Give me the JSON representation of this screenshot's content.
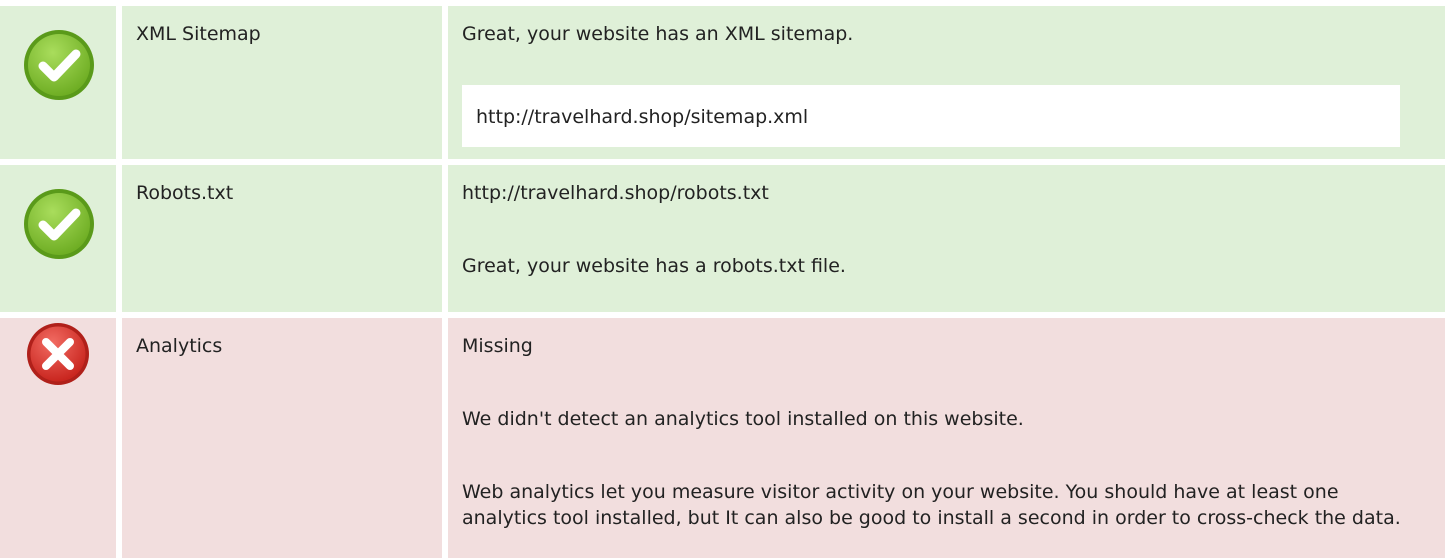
{
  "colors": {
    "pass_background": "#dff0d8",
    "fail_background": "#f2dede",
    "pass_icon": "#8cc63e",
    "fail_icon": "#e2443c"
  },
  "checks": [
    {
      "status": "pass",
      "icon": "check-icon",
      "name": "XML Sitemap",
      "message": "Great, your website has an XML sitemap.",
      "url": "http://travelhard.shop/sitemap.xml"
    },
    {
      "status": "pass",
      "icon": "check-icon",
      "name": "Robots.txt",
      "url": "http://travelhard.shop/robots.txt",
      "message": "Great, your website has a robots.txt file."
    },
    {
      "status": "fail",
      "icon": "cross-icon",
      "name": "Analytics",
      "result": "Missing",
      "message": "We didn't detect an analytics tool installed on this website.",
      "advice": "Web analytics let you measure visitor activity on your website. You should have at least one analytics tool installed, but It can also be good to install a second in order to cross-check the data."
    }
  ]
}
